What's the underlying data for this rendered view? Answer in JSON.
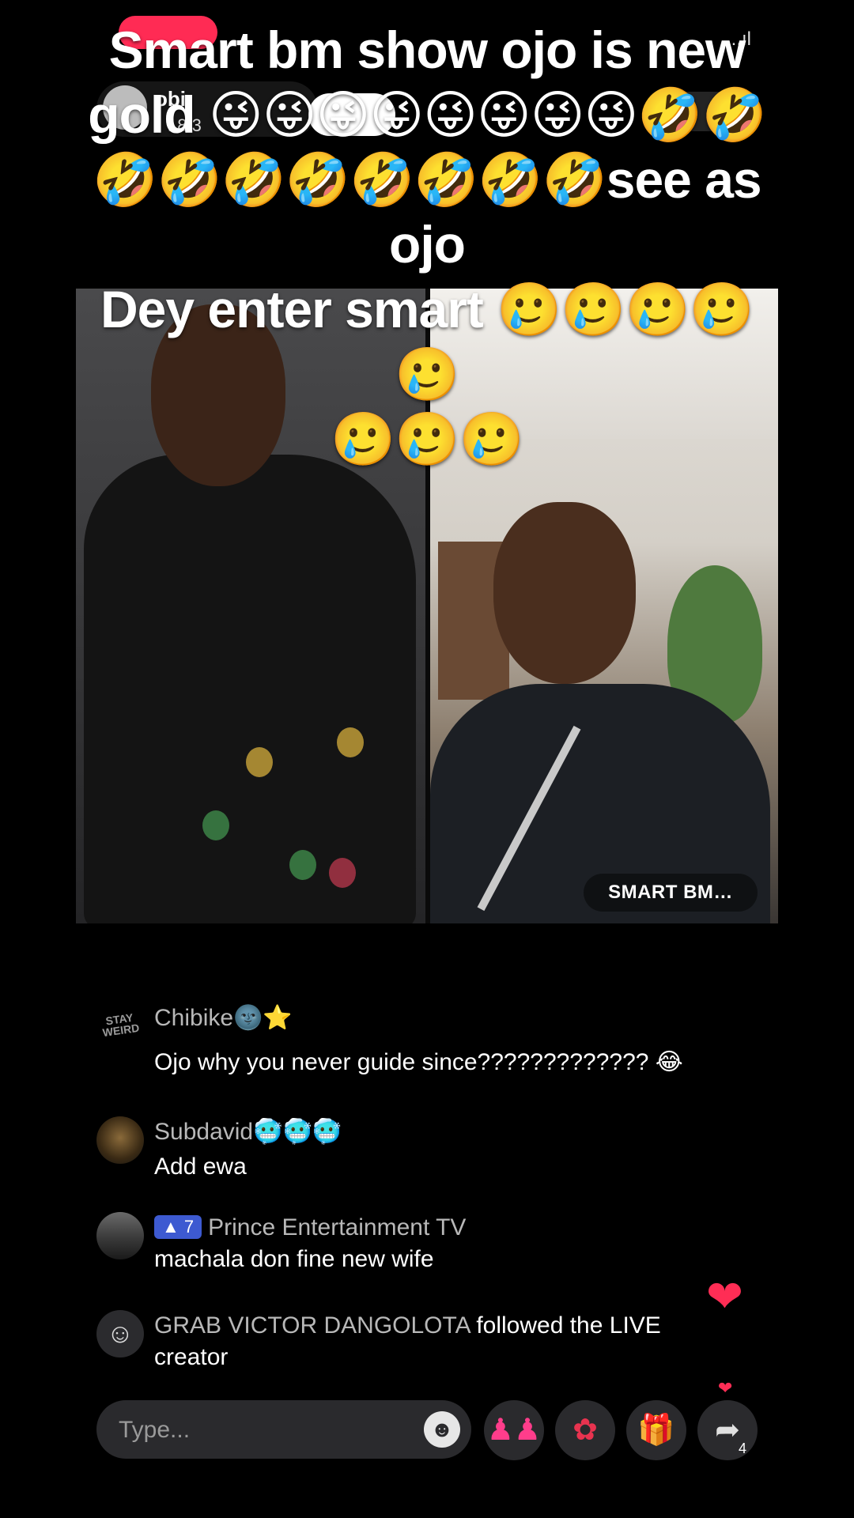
{
  "header": {
    "host_name": "obi",
    "host_likes": "18.3",
    "top_icons_text": "...ıl"
  },
  "caption": {
    "line1": "Smart bm show ojo is new",
    "line2": "gold 😜😜😜😜😜😜😜😜🤣🤣",
    "line3": "🤣🤣🤣🤣🤣🤣🤣🤣see as ojo",
    "line4": "Dey enter smart 🥲🥲🥲🥲🥲",
    "line5": "🥲🥲🥲"
  },
  "battle": {
    "right_name_tag": "SMART BM…"
  },
  "comments": [
    {
      "username": "Chibike🌚⭐",
      "text": "Ojo why you never guide since????????????? 😂",
      "avatar_logo": "STAY WEIRD"
    },
    {
      "username": "Subdavid🥶🥶🥶",
      "text": "Add ewa"
    },
    {
      "badge": "7",
      "username": "Prince Entertainment TV",
      "text": "machala don fine new wife"
    },
    {
      "username": "GRAB VICTOR DANGOLOTA",
      "text": "followed the LIVE creator"
    }
  ],
  "bottom_bar": {
    "type_placeholder": "Type...",
    "share_count": "4"
  },
  "icons": {
    "heart": "heart-icon",
    "emoji": "emoji-icon",
    "guests": "guests-icon",
    "rose": "rose-icon",
    "gift": "gift-icon",
    "share": "share-icon"
  },
  "colors": {
    "live_red": "#ff2b54",
    "heart": "#ff2d55",
    "badge_blue": "#3d5ad1"
  }
}
